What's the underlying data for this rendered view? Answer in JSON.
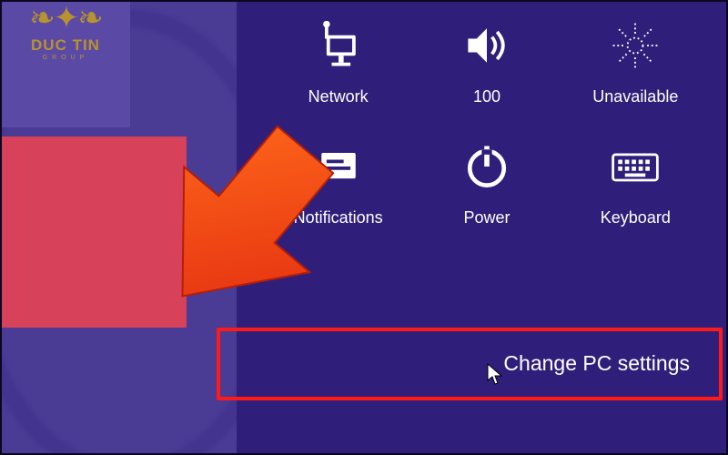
{
  "watermark": {
    "brand": "DUC TIN",
    "sub": "GROUP"
  },
  "settings": {
    "items": [
      {
        "label": "Network"
      },
      {
        "label": "100"
      },
      {
        "label": "Unavailable"
      },
      {
        "label": "Notifications"
      },
      {
        "label": "Power"
      },
      {
        "label": "Keyboard"
      }
    ],
    "change_link": "Change PC settings"
  }
}
